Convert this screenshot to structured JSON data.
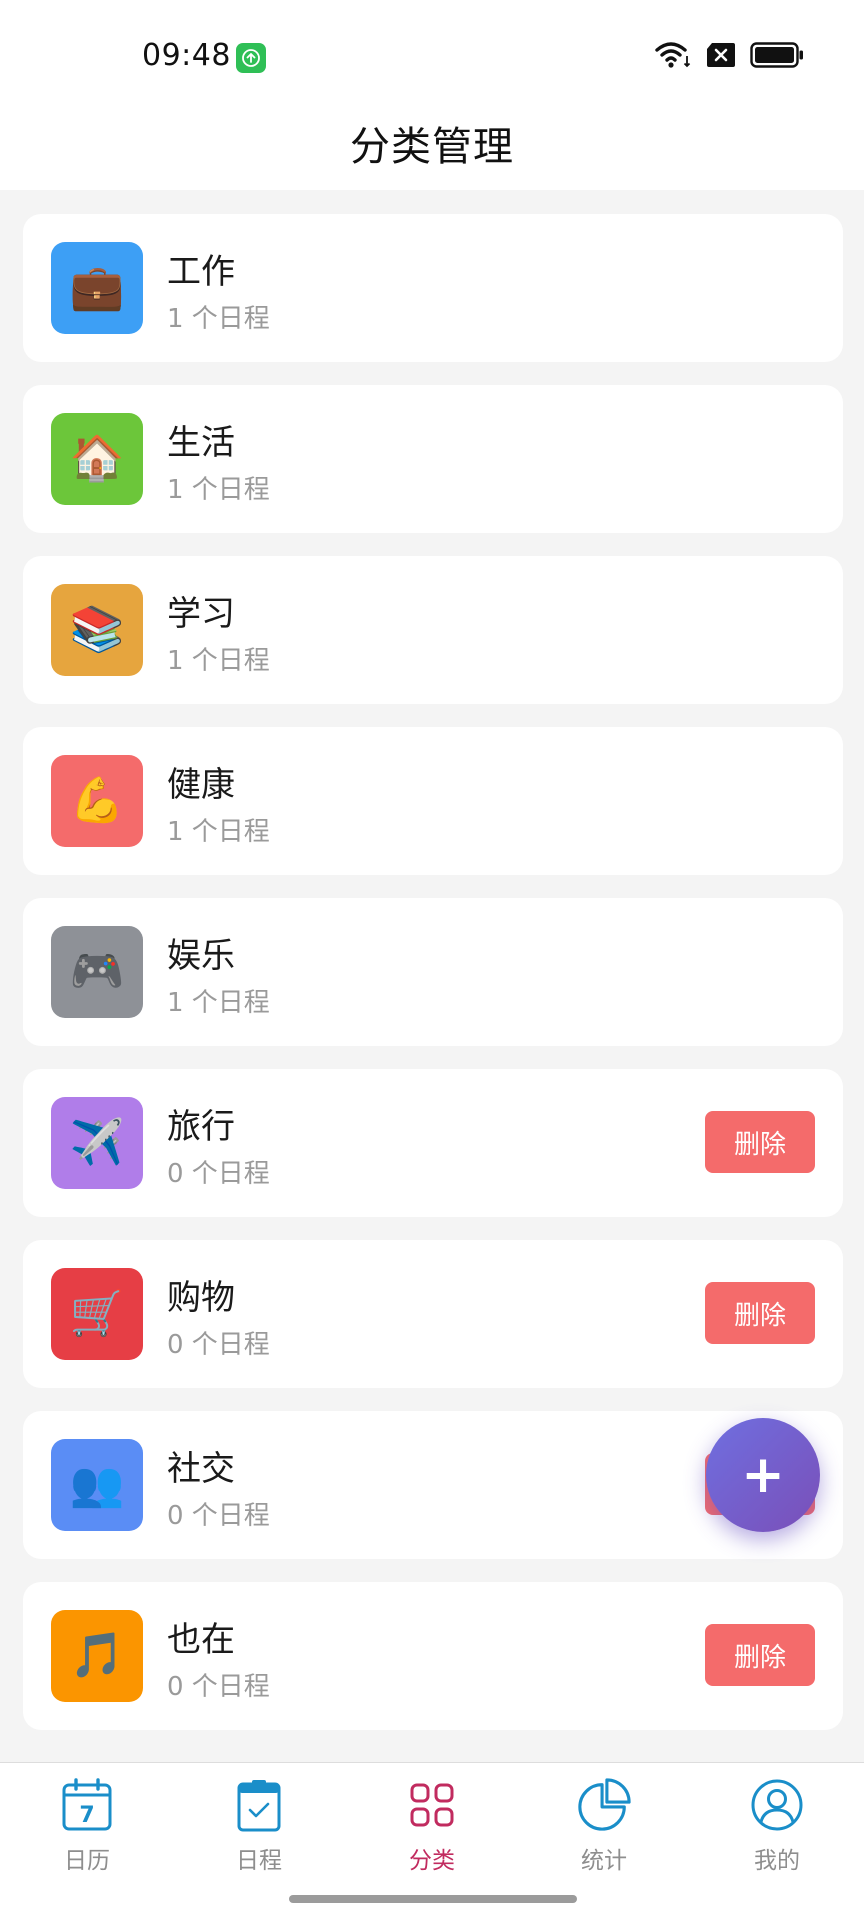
{
  "status_bar": {
    "time": "09:48",
    "app_badge_icon": "upload-arrow-icon",
    "wifi_icon": "wifi-icon",
    "sim_icon": "no-sim-icon",
    "battery_icon": "battery-full-icon"
  },
  "header": {
    "title": "分类管理"
  },
  "categories": [
    {
      "name": "工作",
      "count": "1 个日程",
      "emoji": "💼",
      "icon": "briefcase-icon",
      "color": "#3d9ff5",
      "deletable": false
    },
    {
      "name": "生活",
      "count": "1 个日程",
      "emoji": "🏠",
      "icon": "house-icon",
      "color": "#6cc63a",
      "deletable": false
    },
    {
      "name": "学习",
      "count": "1 个日程",
      "emoji": "📚",
      "icon": "books-icon",
      "color": "#e6a53e",
      "deletable": false
    },
    {
      "name": "健康",
      "count": "1 个日程",
      "emoji": "💪",
      "icon": "flexed-biceps-icon",
      "color": "#f46b6b",
      "deletable": false
    },
    {
      "name": "娱乐",
      "count": "1 个日程",
      "emoji": "🎮",
      "icon": "game-controller-icon",
      "color": "#8e9197",
      "deletable": false
    },
    {
      "name": "旅行",
      "count": "0 个日程",
      "emoji": "✈️",
      "icon": "airplane-icon",
      "color": "#b07de9",
      "deletable": true,
      "delete_label": "删除"
    },
    {
      "name": "购物",
      "count": "0 个日程",
      "emoji": "🛒",
      "icon": "shopping-cart-icon",
      "color": "#e63e45",
      "deletable": true,
      "delete_label": "删除"
    },
    {
      "name": "社交",
      "count": "0 个日程",
      "emoji": "👥",
      "icon": "people-icon",
      "color": "#5a8df5",
      "deletable": true,
      "delete_label": "删除"
    },
    {
      "name": "也在",
      "count": "0 个日程",
      "emoji": "🎵",
      "icon": "music-note-icon",
      "color": "#fb9500",
      "deletable": true,
      "delete_label": "删除"
    }
  ],
  "fab": {
    "label": "+",
    "icon": "plus-icon",
    "colors": [
      "#6f6fe0",
      "#7a4fb8"
    ]
  },
  "tabbar": {
    "active": "分类",
    "active_color": "#c12b5f",
    "inactive_color": "#8e8e8e",
    "icon_color": "#1a8ec9",
    "tabs": [
      {
        "label": "日历",
        "icon": "calendar-icon",
        "calendar_day": "7"
      },
      {
        "label": "日程",
        "icon": "clipboard-check-icon"
      },
      {
        "label": "分类",
        "icon": "grid-icon"
      },
      {
        "label": "统计",
        "icon": "pie-chart-icon"
      },
      {
        "label": "我的",
        "icon": "user-icon"
      }
    ]
  }
}
